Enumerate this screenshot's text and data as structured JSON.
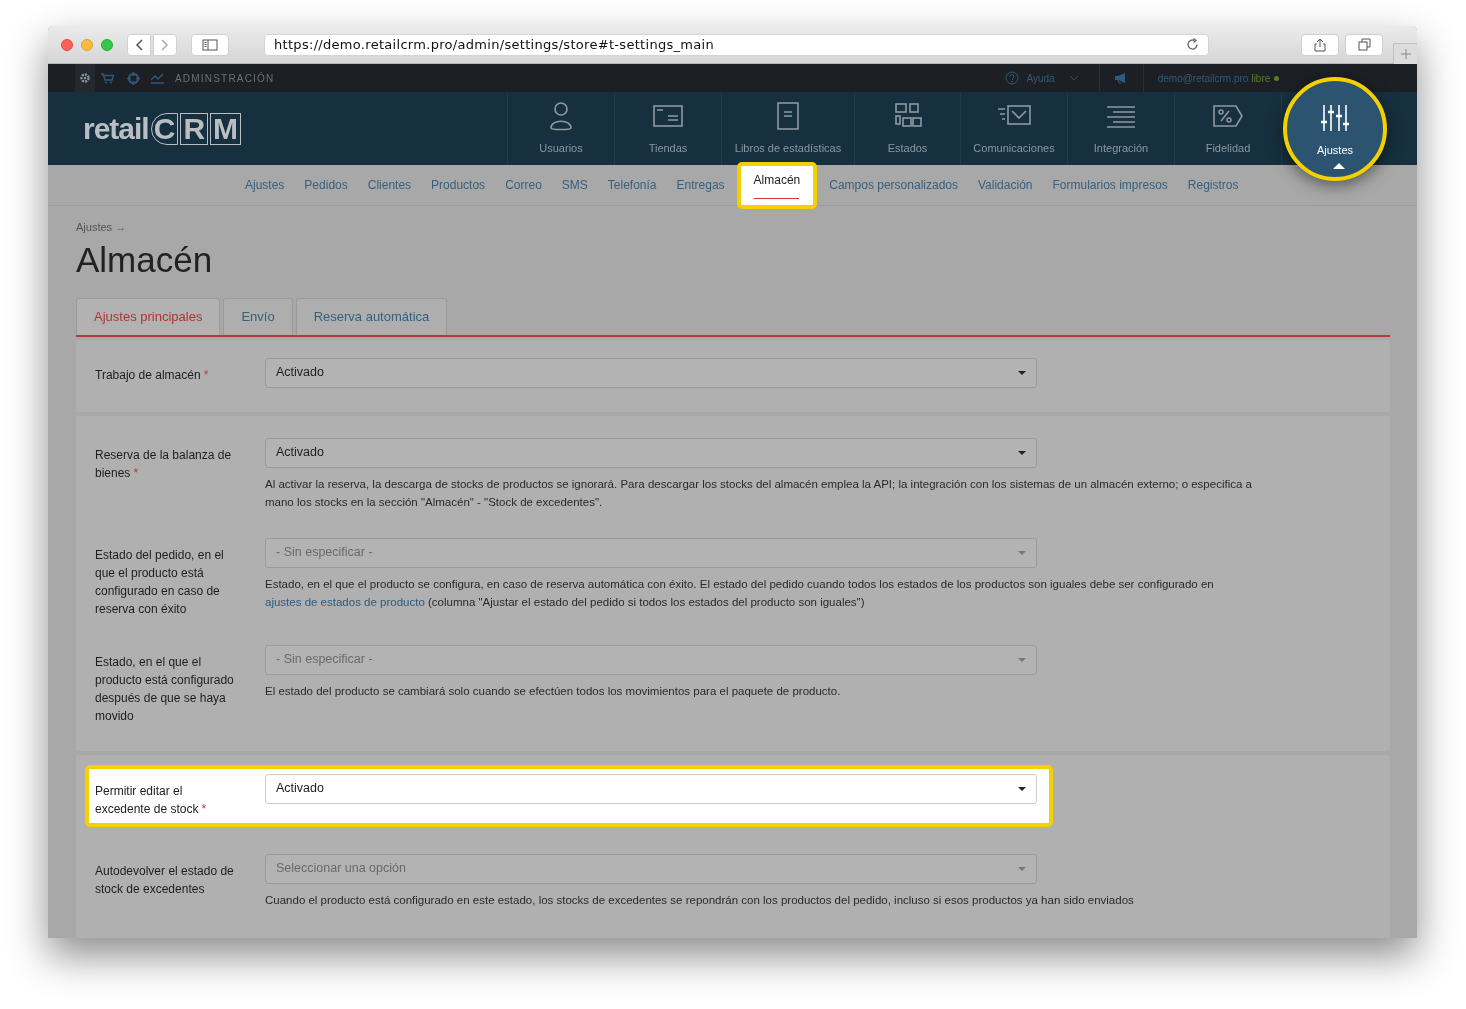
{
  "browser": {
    "url": "https://demo.retailcrm.pro/admin/settings/store#t-settings_main"
  },
  "logo": {
    "word": "retail",
    "letters": [
      "C",
      "R",
      "M"
    ]
  },
  "top_bar": {
    "section_label": "ADMINSTRACIÓN",
    "help": "Ayuda",
    "user": "demo@retailcrm.pro",
    "plan": "libre"
  },
  "main_nav": [
    {
      "label": "Usuarios",
      "kind": "user",
      "selected": false,
      "highlighted": false
    },
    {
      "label": "Tiendas",
      "kind": "store",
      "selected": false,
      "highlighted": false
    },
    {
      "label": "Libros de estadísticas",
      "kind": "book",
      "selected": false,
      "highlighted": false
    },
    {
      "label": "Estados",
      "kind": "grid",
      "selected": false,
      "highlighted": false
    },
    {
      "label": "Comunicaciones",
      "kind": "mail",
      "selected": false,
      "highlighted": false
    },
    {
      "label": "Integración",
      "kind": "lines",
      "selected": false,
      "highlighted": false
    },
    {
      "label": "Fidelidad",
      "kind": "percent",
      "selected": false,
      "highlighted": false
    },
    {
      "label": "Ajustes",
      "kind": "sliders",
      "selected": true,
      "highlighted": true
    }
  ],
  "sub_nav": [
    {
      "label": "Ajustes",
      "selected": false,
      "highlighted": false
    },
    {
      "label": "Pedidos",
      "selected": false,
      "highlighted": false
    },
    {
      "label": "Clientes",
      "selected": false,
      "highlighted": false
    },
    {
      "label": "Productos",
      "selected": false,
      "highlighted": false
    },
    {
      "label": "Correo",
      "selected": false,
      "highlighted": false
    },
    {
      "label": "SMS",
      "selected": false,
      "highlighted": false
    },
    {
      "label": "Telefonía",
      "selected": false,
      "highlighted": false
    },
    {
      "label": "Entregas",
      "selected": false,
      "highlighted": false
    },
    {
      "label": "Almacén",
      "selected": true,
      "highlighted": true
    },
    {
      "label": "Campos personalizados",
      "selected": false,
      "highlighted": false
    },
    {
      "label": "Validación",
      "selected": false,
      "highlighted": false
    },
    {
      "label": "Formularios impresos",
      "selected": false,
      "highlighted": false
    },
    {
      "label": "Registros",
      "selected": false,
      "highlighted": false
    }
  ],
  "breadcrumb": "Ajustes →",
  "title": "Almacén",
  "tabs": [
    {
      "label": "Ajustes principales",
      "selected": true
    },
    {
      "label": "Envío",
      "selected": false
    },
    {
      "label": "Reserva automática",
      "selected": false
    }
  ],
  "sections": [
    {
      "fields": [
        {
          "label": "Trabajo de almacén",
          "required_mark": "*",
          "value": "Activado",
          "highlighted": false
        }
      ]
    },
    {
      "fields": [
        {
          "label": "Reserva de la balanza de bienes",
          "required_mark": "*",
          "value": "Activado",
          "highlighted": false,
          "hint": [
            {
              "text": "Al activar la reserva, la descarga de stocks de productos se ignorará. Para descargar los stocks del almacén emplea la API; la integración con los sistemas de un almacén externo; o especifica a mano los stocks en la sección \"Almacén\" - \"Stock de excedentes\".",
              "link": false
            }
          ]
        },
        {
          "label": "Estado del pedido, en el que el producto está configurado en caso de reserva con éxito",
          "placeholder": "- Sin especificar -",
          "highlighted": false,
          "hint": [
            {
              "text": "Estado, en el que el producto se configura, en caso de reserva automática con éxito. El estado del pedido cuando todos los estados de los productos son iguales debe ser configurado en ",
              "link": false
            },
            {
              "text": "ajustes de estados de producto",
              "link": true
            },
            {
              "text": " (columna \"Ajustar el estado del pedido si todos los estados del producto son iguales\")",
              "link": false
            }
          ]
        },
        {
          "label": "Estado, en el que el producto está configurado después de que se haya movido",
          "placeholder": "- Sin especificar -",
          "highlighted": false,
          "hint": [
            {
              "text": "El estado del producto se cambiará solo cuando se efectúen todos los movimientos para el paquete de producto.",
              "link": false
            }
          ]
        }
      ]
    },
    {
      "fields": [
        {
          "label": "Permitir editar el excedente de stock",
          "required_mark": "*",
          "value": "Activado",
          "highlighted": true
        },
        {
          "label": "Autodevolver el estado de stock de excedentes",
          "placeholder": "Seleccionar una opción",
          "highlighted": false,
          "hint": [
            {
              "text": "Cuando el producto está configurado en este estado, los stocks de excedentes se repondrán con los productos del pedido, incluso si esos productos ya han sido enviados",
              "link": false
            }
          ]
        }
      ]
    }
  ]
}
